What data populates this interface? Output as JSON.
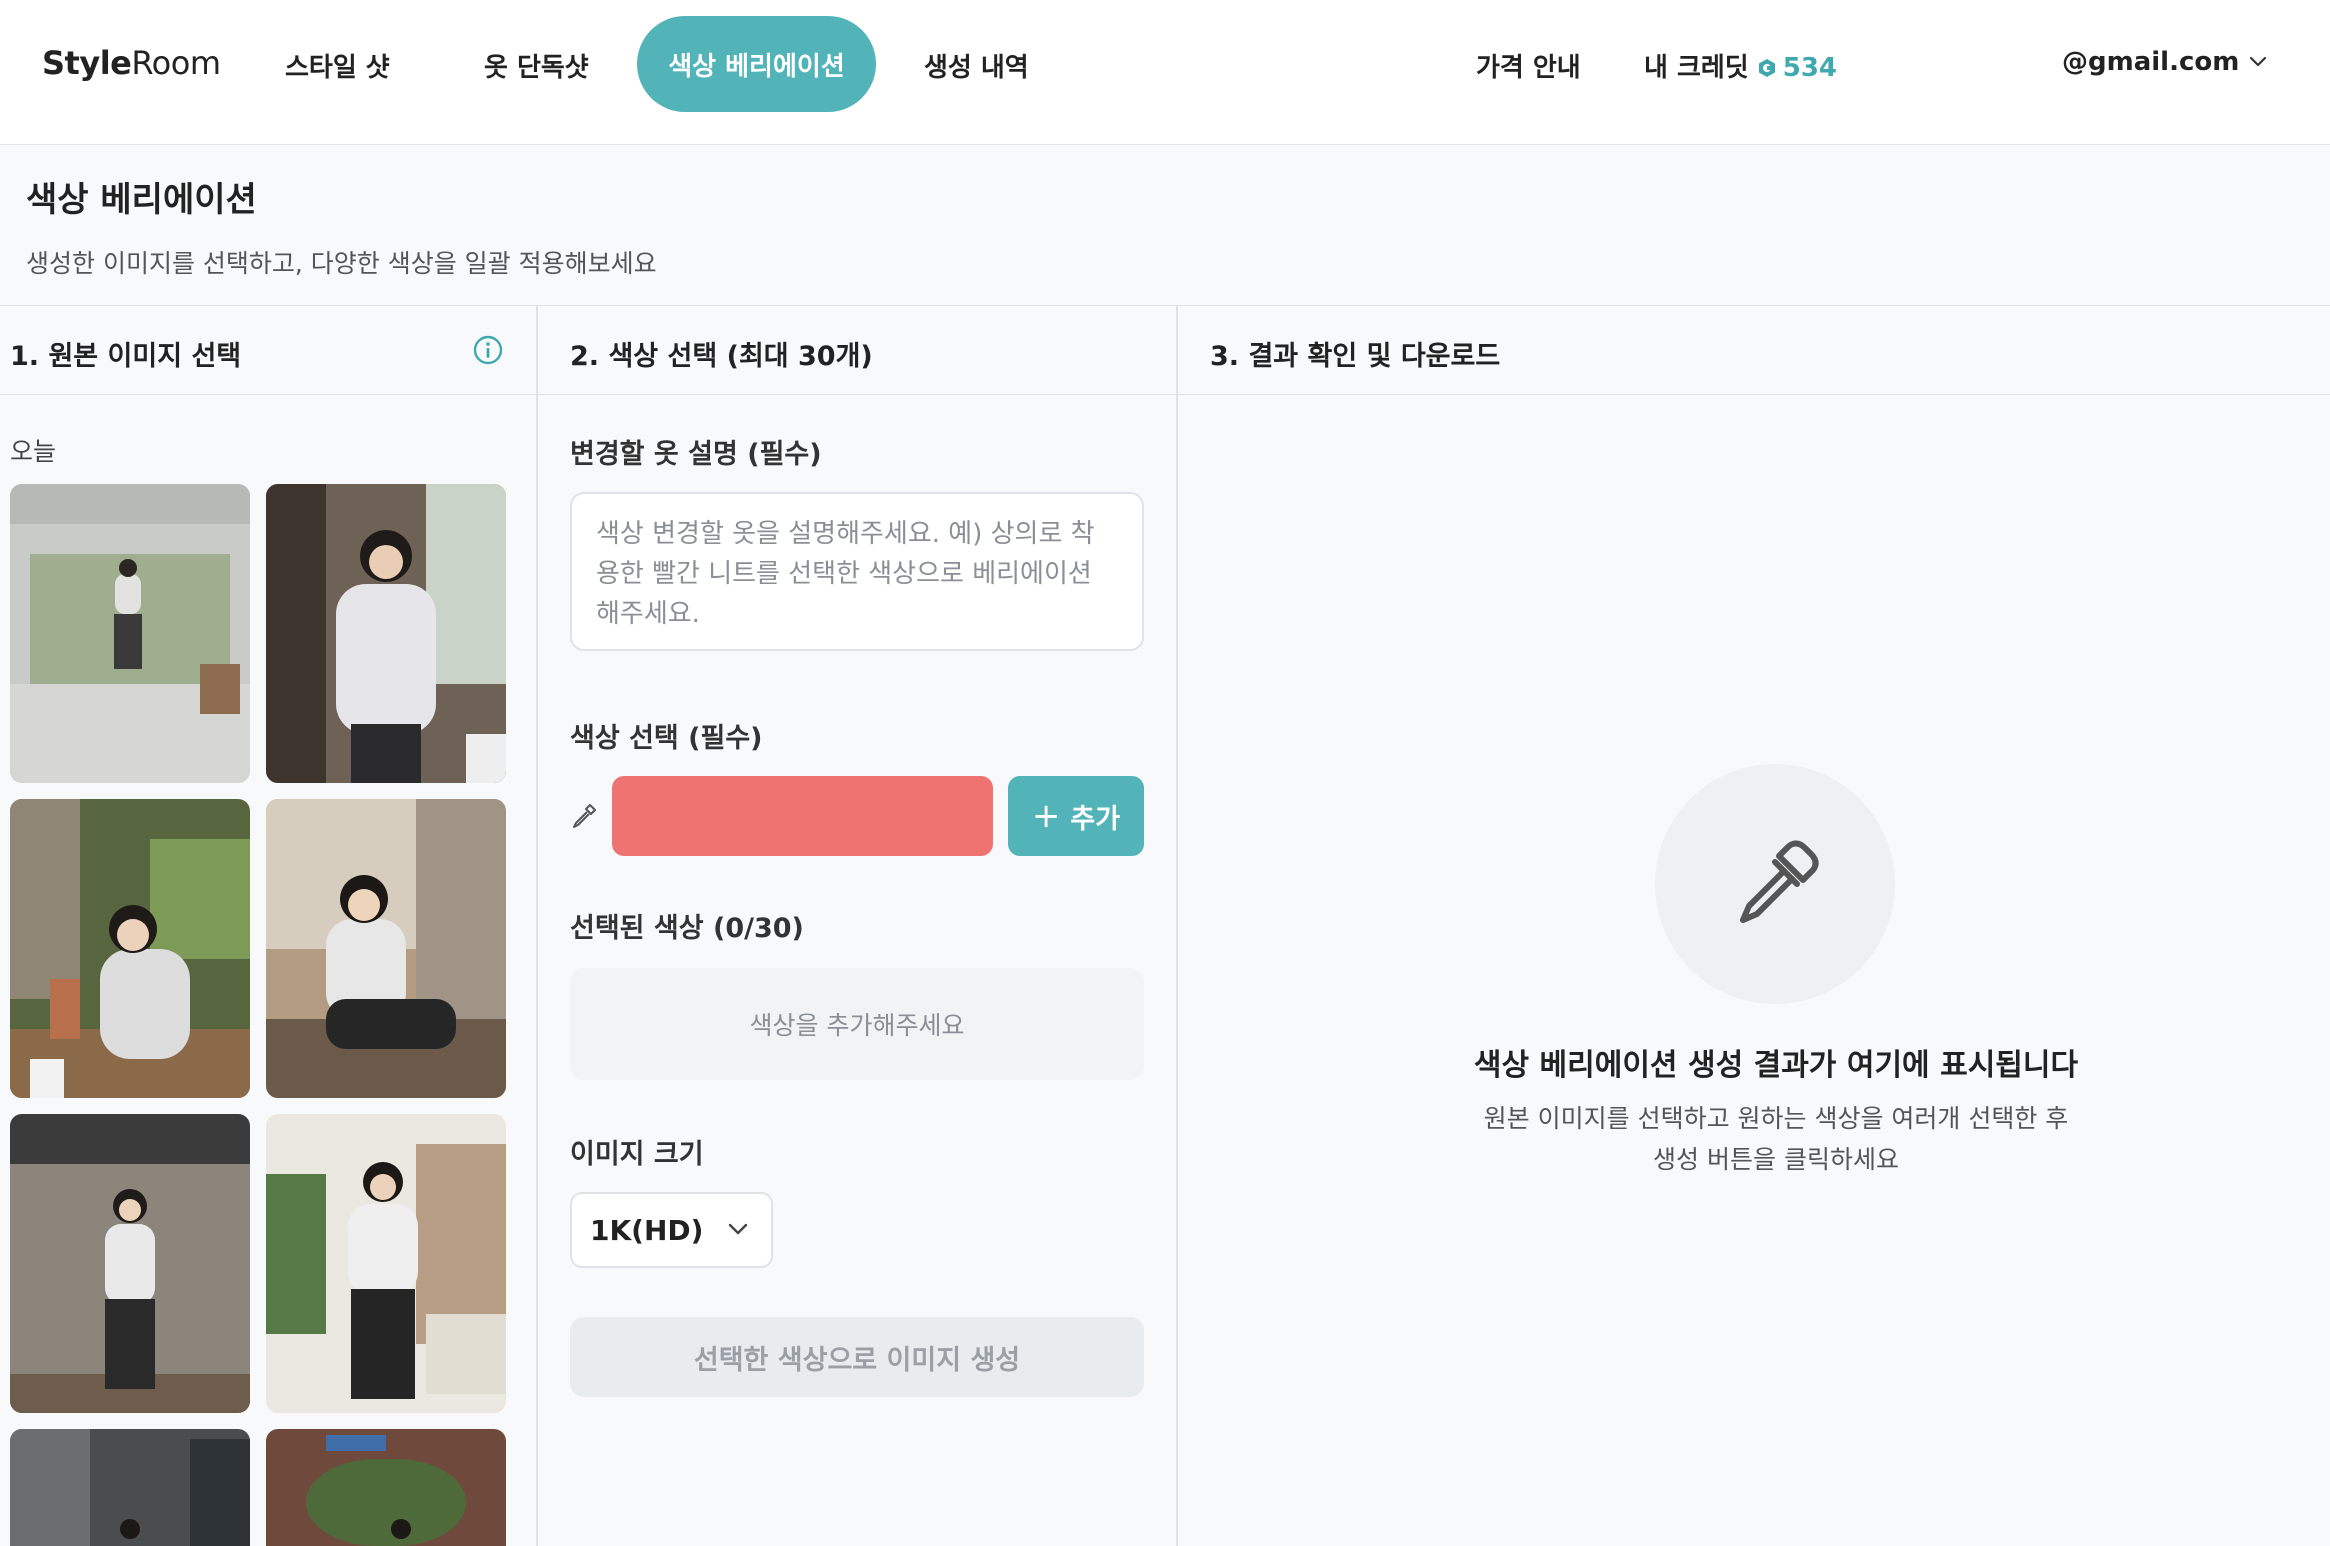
{
  "nav": {
    "logo_bold": "Style",
    "logo_rest": "Room",
    "items": [
      "스타일 샷",
      "옷 단독샷",
      "색상 베리에이션",
      "생성 내역"
    ],
    "pricing": "가격 안내",
    "credits_label": "내 크레딧",
    "credits_value": "534",
    "user_email": "@gmail.com"
  },
  "page": {
    "title": "색상 베리에이션",
    "subtitle": "생성한 이미지를 선택하고, 다양한 색상을 일괄 적용해보세요"
  },
  "col1": {
    "heading": "1. 원본 이미지 선택",
    "group_label": "오늘"
  },
  "col2": {
    "heading": "2. 색상 선택 (최대 30개)",
    "desc_label": "변경할 옷 설명 (필수)",
    "desc_placeholder": "색상 변경할 옷을 설명해주세요. 예) 상의로 착용한 빨간 니트를 선택한 색상으로 베리에이션 해주세요.",
    "color_label": "색상 선택 (필수)",
    "color_value": "#ee7371",
    "add_button": "추가",
    "selected_label": "선택된 색상 (0/30)",
    "empty_colors": "색상을 추가해주세요",
    "size_label": "이미지 크기",
    "size_value": "1K(HD)",
    "generate_button": "선택한 색상으로 이미지 생성"
  },
  "col3": {
    "heading": "3. 결과 확인 및 다운로드",
    "empty_title": "색상 베리에이션 생성 결과가 여기에 표시됩니다",
    "empty_desc_1": "원본 이미지를 선택하고 원하는 색상을 여러개 선택한 후",
    "empty_desc_2": "생성 버튼을 클릭하세요"
  },
  "colors": {
    "accent": "#52b3b8",
    "swatch": "#ee7371"
  }
}
